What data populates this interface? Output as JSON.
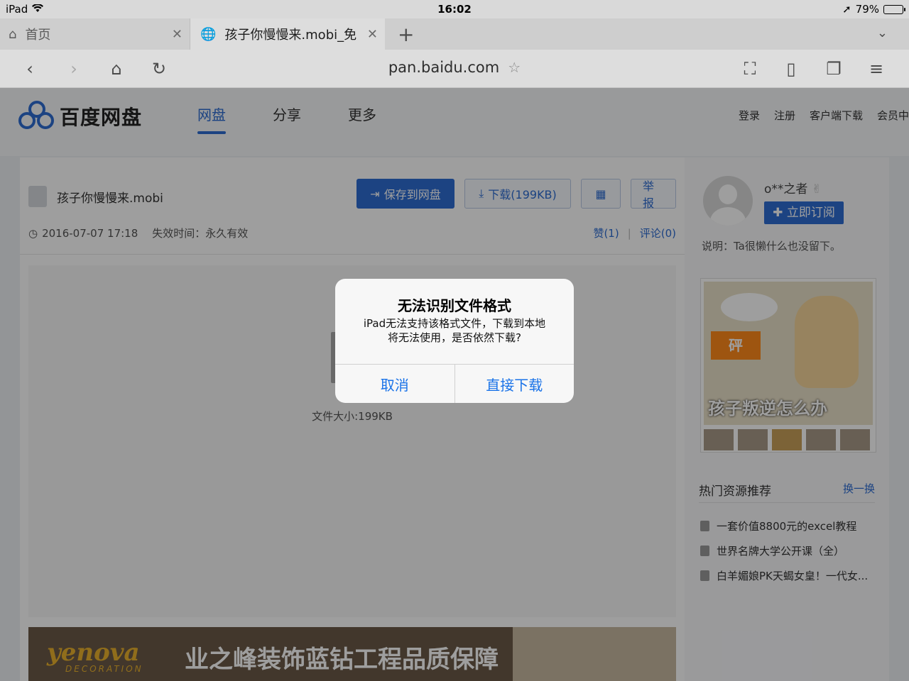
{
  "status_bar": {
    "device": "iPad",
    "time": "16:02",
    "battery_text": "79%",
    "battery_level": 0.79
  },
  "tabs": [
    {
      "label": "首页",
      "icon": "home-icon"
    },
    {
      "label": "孩子你慢慢来.mobi_免",
      "icon": "globe-icon",
      "active": true
    }
  ],
  "toolbar": {
    "url": "pan.baidu.com"
  },
  "site": {
    "logo_text": "百度网盘",
    "nav": [
      "网盘",
      "分享",
      "更多"
    ],
    "header_links": [
      "登录",
      "注册",
      "客户端下载",
      "会员中"
    ],
    "accent_color": "#2e6dd2"
  },
  "file": {
    "name": "孩子你慢慢来.mobi",
    "date": "2016-07-07 17:18",
    "expiry": "失效时间：永久有效",
    "save_label": "保存到网盘",
    "download_label": "下载(199KB)",
    "report_label": "举报",
    "likes": "赞(1)",
    "comments": "评论(0)",
    "size": "文件大小:199KB"
  },
  "ad": {
    "logo": "yenova",
    "logo_sub": "DECORATION",
    "text": "业之峰装饰蓝钻工程品质保障"
  },
  "sidebar": {
    "username": "o**之者",
    "subscribe_label": "立即订阅",
    "description": "说明：Ta很懒什么也没留下。",
    "comic_caption": "孩子叛逆怎么办",
    "comic_burst": "砰",
    "hot_title": "热门资源推荐",
    "hot_switch": "换一换",
    "hot_items": [
      "一套价值8800元的excel教程",
      "世界名牌大学公开课（全）",
      "白羊媚娘PK天蝎女皇！一代女..."
    ]
  },
  "dialog": {
    "title": "无法识别文件格式",
    "message_line1": "iPad无法支持该格式文件，下载到本地",
    "message_line2": "将无法使用，是否依然下载?",
    "cancel_label": "取消",
    "confirm_label": "直接下载"
  }
}
